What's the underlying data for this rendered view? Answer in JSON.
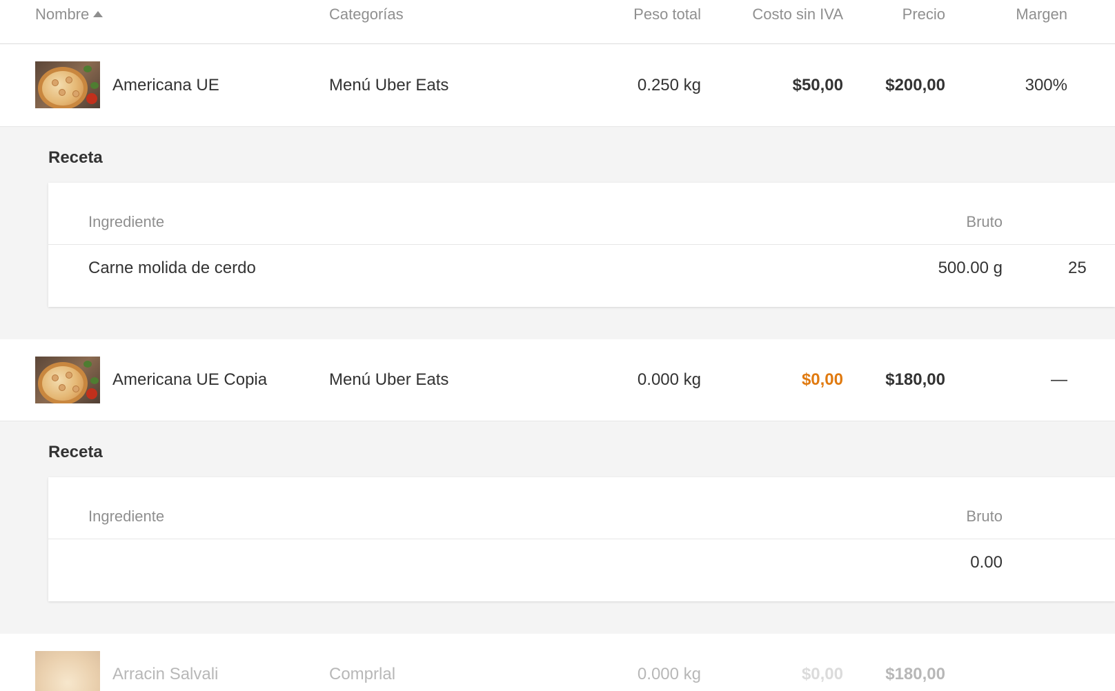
{
  "columns": {
    "name": "Nombre",
    "categories": "Categorías",
    "weight": "Peso total",
    "cost": "Costo sin IVA",
    "price": "Precio",
    "margin": "Margen"
  },
  "products": [
    {
      "name": "Americana UE",
      "category": "Menú Uber Eats",
      "weight": "0.250 kg",
      "cost": "$50,00",
      "price": "$200,00",
      "margin": "300%",
      "recipe": {
        "title": "Receta",
        "col_ingredient": "Ingrediente",
        "col_gross": "Bruto",
        "rows": [
          {
            "ingredient": "Carne molida de cerdo",
            "gross": "500.00 g",
            "next": "25"
          }
        ]
      }
    },
    {
      "name": "Americana UE Copia",
      "category": "Menú Uber Eats",
      "weight": "0.000 kg",
      "cost": "$0,00",
      "price": "$180,00",
      "margin": "—",
      "recipe": {
        "title": "Receta",
        "col_ingredient": "Ingrediente",
        "col_gross": "Bruto",
        "rows": [
          {
            "ingredient": "",
            "gross": "0.00"
          }
        ]
      }
    },
    {
      "name": "Arracin Salvali",
      "category": "Comprlal",
      "weight": "0.000 kg",
      "cost": "$0,00",
      "price": "$180,00"
    }
  ],
  "colors": {
    "warning_cost": "#e07a10",
    "header_text": "#8f8f8f"
  }
}
